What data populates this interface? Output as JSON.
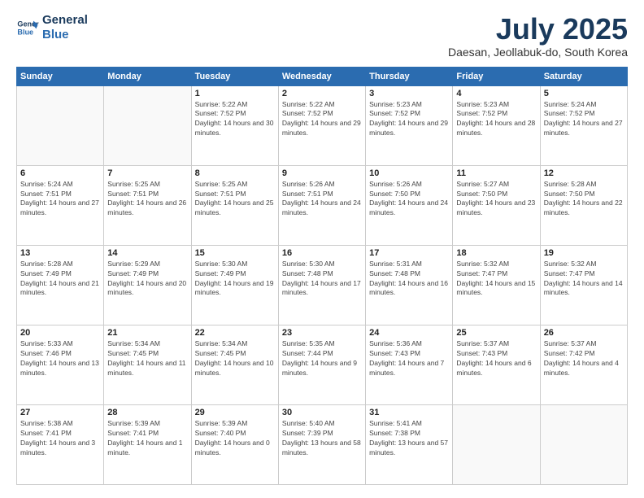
{
  "logo": {
    "line1": "General",
    "line2": "Blue"
  },
  "title": "July 2025",
  "location": "Daesan, Jeollabuk-do, South Korea",
  "weekdays": [
    "Sunday",
    "Monday",
    "Tuesday",
    "Wednesday",
    "Thursday",
    "Friday",
    "Saturday"
  ],
  "weeks": [
    [
      {
        "day": "",
        "sunrise": "",
        "sunset": "",
        "daylight": ""
      },
      {
        "day": "",
        "sunrise": "",
        "sunset": "",
        "daylight": ""
      },
      {
        "day": "1",
        "sunrise": "Sunrise: 5:22 AM",
        "sunset": "Sunset: 7:52 PM",
        "daylight": "Daylight: 14 hours and 30 minutes."
      },
      {
        "day": "2",
        "sunrise": "Sunrise: 5:22 AM",
        "sunset": "Sunset: 7:52 PM",
        "daylight": "Daylight: 14 hours and 29 minutes."
      },
      {
        "day": "3",
        "sunrise": "Sunrise: 5:23 AM",
        "sunset": "Sunset: 7:52 PM",
        "daylight": "Daylight: 14 hours and 29 minutes."
      },
      {
        "day": "4",
        "sunrise": "Sunrise: 5:23 AM",
        "sunset": "Sunset: 7:52 PM",
        "daylight": "Daylight: 14 hours and 28 minutes."
      },
      {
        "day": "5",
        "sunrise": "Sunrise: 5:24 AM",
        "sunset": "Sunset: 7:52 PM",
        "daylight": "Daylight: 14 hours and 27 minutes."
      }
    ],
    [
      {
        "day": "6",
        "sunrise": "Sunrise: 5:24 AM",
        "sunset": "Sunset: 7:51 PM",
        "daylight": "Daylight: 14 hours and 27 minutes."
      },
      {
        "day": "7",
        "sunrise": "Sunrise: 5:25 AM",
        "sunset": "Sunset: 7:51 PM",
        "daylight": "Daylight: 14 hours and 26 minutes."
      },
      {
        "day": "8",
        "sunrise": "Sunrise: 5:25 AM",
        "sunset": "Sunset: 7:51 PM",
        "daylight": "Daylight: 14 hours and 25 minutes."
      },
      {
        "day": "9",
        "sunrise": "Sunrise: 5:26 AM",
        "sunset": "Sunset: 7:51 PM",
        "daylight": "Daylight: 14 hours and 24 minutes."
      },
      {
        "day": "10",
        "sunrise": "Sunrise: 5:26 AM",
        "sunset": "Sunset: 7:50 PM",
        "daylight": "Daylight: 14 hours and 24 minutes."
      },
      {
        "day": "11",
        "sunrise": "Sunrise: 5:27 AM",
        "sunset": "Sunset: 7:50 PM",
        "daylight": "Daylight: 14 hours and 23 minutes."
      },
      {
        "day": "12",
        "sunrise": "Sunrise: 5:28 AM",
        "sunset": "Sunset: 7:50 PM",
        "daylight": "Daylight: 14 hours and 22 minutes."
      }
    ],
    [
      {
        "day": "13",
        "sunrise": "Sunrise: 5:28 AM",
        "sunset": "Sunset: 7:49 PM",
        "daylight": "Daylight: 14 hours and 21 minutes."
      },
      {
        "day": "14",
        "sunrise": "Sunrise: 5:29 AM",
        "sunset": "Sunset: 7:49 PM",
        "daylight": "Daylight: 14 hours and 20 minutes."
      },
      {
        "day": "15",
        "sunrise": "Sunrise: 5:30 AM",
        "sunset": "Sunset: 7:49 PM",
        "daylight": "Daylight: 14 hours and 19 minutes."
      },
      {
        "day": "16",
        "sunrise": "Sunrise: 5:30 AM",
        "sunset": "Sunset: 7:48 PM",
        "daylight": "Daylight: 14 hours and 17 minutes."
      },
      {
        "day": "17",
        "sunrise": "Sunrise: 5:31 AM",
        "sunset": "Sunset: 7:48 PM",
        "daylight": "Daylight: 14 hours and 16 minutes."
      },
      {
        "day": "18",
        "sunrise": "Sunrise: 5:32 AM",
        "sunset": "Sunset: 7:47 PM",
        "daylight": "Daylight: 14 hours and 15 minutes."
      },
      {
        "day": "19",
        "sunrise": "Sunrise: 5:32 AM",
        "sunset": "Sunset: 7:47 PM",
        "daylight": "Daylight: 14 hours and 14 minutes."
      }
    ],
    [
      {
        "day": "20",
        "sunrise": "Sunrise: 5:33 AM",
        "sunset": "Sunset: 7:46 PM",
        "daylight": "Daylight: 14 hours and 13 minutes."
      },
      {
        "day": "21",
        "sunrise": "Sunrise: 5:34 AM",
        "sunset": "Sunset: 7:45 PM",
        "daylight": "Daylight: 14 hours and 11 minutes."
      },
      {
        "day": "22",
        "sunrise": "Sunrise: 5:34 AM",
        "sunset": "Sunset: 7:45 PM",
        "daylight": "Daylight: 14 hours and 10 minutes."
      },
      {
        "day": "23",
        "sunrise": "Sunrise: 5:35 AM",
        "sunset": "Sunset: 7:44 PM",
        "daylight": "Daylight: 14 hours and 9 minutes."
      },
      {
        "day": "24",
        "sunrise": "Sunrise: 5:36 AM",
        "sunset": "Sunset: 7:43 PM",
        "daylight": "Daylight: 14 hours and 7 minutes."
      },
      {
        "day": "25",
        "sunrise": "Sunrise: 5:37 AM",
        "sunset": "Sunset: 7:43 PM",
        "daylight": "Daylight: 14 hours and 6 minutes."
      },
      {
        "day": "26",
        "sunrise": "Sunrise: 5:37 AM",
        "sunset": "Sunset: 7:42 PM",
        "daylight": "Daylight: 14 hours and 4 minutes."
      }
    ],
    [
      {
        "day": "27",
        "sunrise": "Sunrise: 5:38 AM",
        "sunset": "Sunset: 7:41 PM",
        "daylight": "Daylight: 14 hours and 3 minutes."
      },
      {
        "day": "28",
        "sunrise": "Sunrise: 5:39 AM",
        "sunset": "Sunset: 7:41 PM",
        "daylight": "Daylight: 14 hours and 1 minute."
      },
      {
        "day": "29",
        "sunrise": "Sunrise: 5:39 AM",
        "sunset": "Sunset: 7:40 PM",
        "daylight": "Daylight: 14 hours and 0 minutes."
      },
      {
        "day": "30",
        "sunrise": "Sunrise: 5:40 AM",
        "sunset": "Sunset: 7:39 PM",
        "daylight": "Daylight: 13 hours and 58 minutes."
      },
      {
        "day": "31",
        "sunrise": "Sunrise: 5:41 AM",
        "sunset": "Sunset: 7:38 PM",
        "daylight": "Daylight: 13 hours and 57 minutes."
      },
      {
        "day": "",
        "sunrise": "",
        "sunset": "",
        "daylight": ""
      },
      {
        "day": "",
        "sunrise": "",
        "sunset": "",
        "daylight": ""
      }
    ]
  ]
}
